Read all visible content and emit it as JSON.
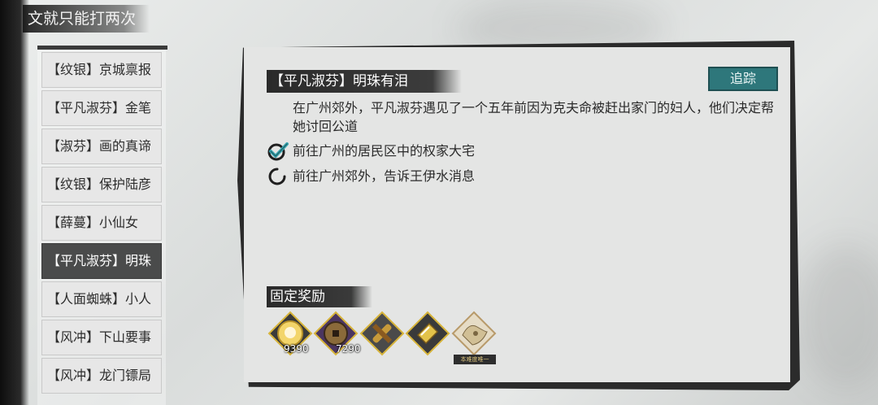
{
  "header": {
    "title": "文就只能打两次"
  },
  "sidebar": {
    "items": [
      {
        "label": "【纹银】京城禀报"
      },
      {
        "label": "【平凡淑芬】金笔"
      },
      {
        "label": "【淑芬】画的真谛"
      },
      {
        "label": "【纹银】保护陆彦"
      },
      {
        "label": "【薛蔓】小仙女"
      },
      {
        "label": "【平凡淑芬】明珠"
      },
      {
        "label": "【人面蜘蛛】小人"
      },
      {
        "label": "【风冲】下山要事"
      },
      {
        "label": "【风冲】龙门镖局"
      }
    ],
    "active_index": 5
  },
  "quest": {
    "title": "【平凡淑芬】明珠有泪",
    "track_label": "追踪",
    "description": "在广州郊外，平凡淑芬遇见了一个五年前因为克夫命被赶出家门的妇人，他们决定帮她讨回公道",
    "objectives": [
      {
        "text": "前往广州的居民区中的权家大宅",
        "status": "completed",
        "icon": "check-icon"
      },
      {
        "text": "前往广州郊外，告诉王伊水消息",
        "status": "in-progress",
        "icon": "progress-ring-icon"
      }
    ]
  },
  "rewards": {
    "header": "固定奖励",
    "items": [
      {
        "icon": "silver-coin-icon",
        "count": "9390",
        "color": "#d7b43a"
      },
      {
        "icon": "copper-coin-icon",
        "count": "7290",
        "color": "#6a4a8a"
      },
      {
        "icon": "scroll-icon",
        "count": "",
        "color": "#5b5b5b"
      },
      {
        "icon": "book-icon",
        "count": "",
        "color": "#c9a227"
      },
      {
        "icon": "map-fragment-icon",
        "count": "",
        "color": "#b89a6a",
        "tag": "本难度唯一"
      }
    ]
  },
  "colors": {
    "track_button": "#2e777b",
    "active_item": "#4a4b4b"
  }
}
